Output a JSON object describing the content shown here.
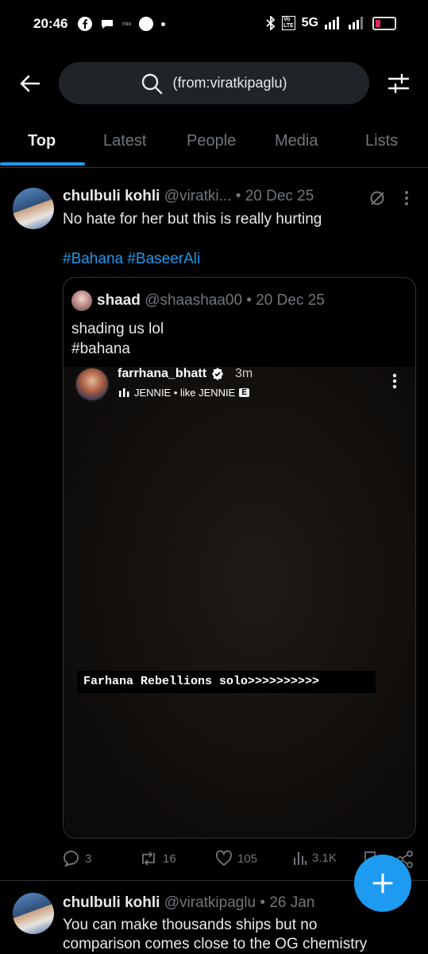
{
  "status_bar": {
    "time": "20:46",
    "network": "5G",
    "tiny_label": "mio"
  },
  "search": {
    "query": "(from:viratkipaglu)"
  },
  "tabs": [
    {
      "label": "Top",
      "active": true
    },
    {
      "label": "Latest",
      "active": false
    },
    {
      "label": "People",
      "active": false
    },
    {
      "label": "Media",
      "active": false
    },
    {
      "label": "Lists",
      "active": false
    }
  ],
  "tweets": [
    {
      "display_name": "chulbuli kohli",
      "handle": "@viratki...",
      "date": "• 20 Dec 25",
      "text": "No hate for her but this is really hurting",
      "hashtags": "#Bahana #BaseerAli",
      "quote": {
        "display_name": "shaad",
        "handle": "@shaashaa00",
        "date": "• 20 Dec 25",
        "line1": "shading us lol",
        "line2": "#bahana",
        "media": {
          "user": "farrhana_bhatt",
          "time": "3m",
          "song": "JENNIE • like JENNIE",
          "explicit": "E",
          "caption": "Farhana Rebellions solo>>>>>>>>>>"
        }
      },
      "actions": {
        "replies": "3",
        "reposts": "16",
        "likes": "105",
        "views": "3.1K"
      }
    },
    {
      "display_name": "chulbuli kohli",
      "handle": "@viratkipaglu",
      "date": "• 26 Jan",
      "line1": "You can make thousands ships but no",
      "line2": "comparison comes close to the OG  chemistry"
    }
  ],
  "colors": {
    "accent": "#1d9bf0",
    "background": "#000000",
    "secondary_text": "#71767b"
  }
}
